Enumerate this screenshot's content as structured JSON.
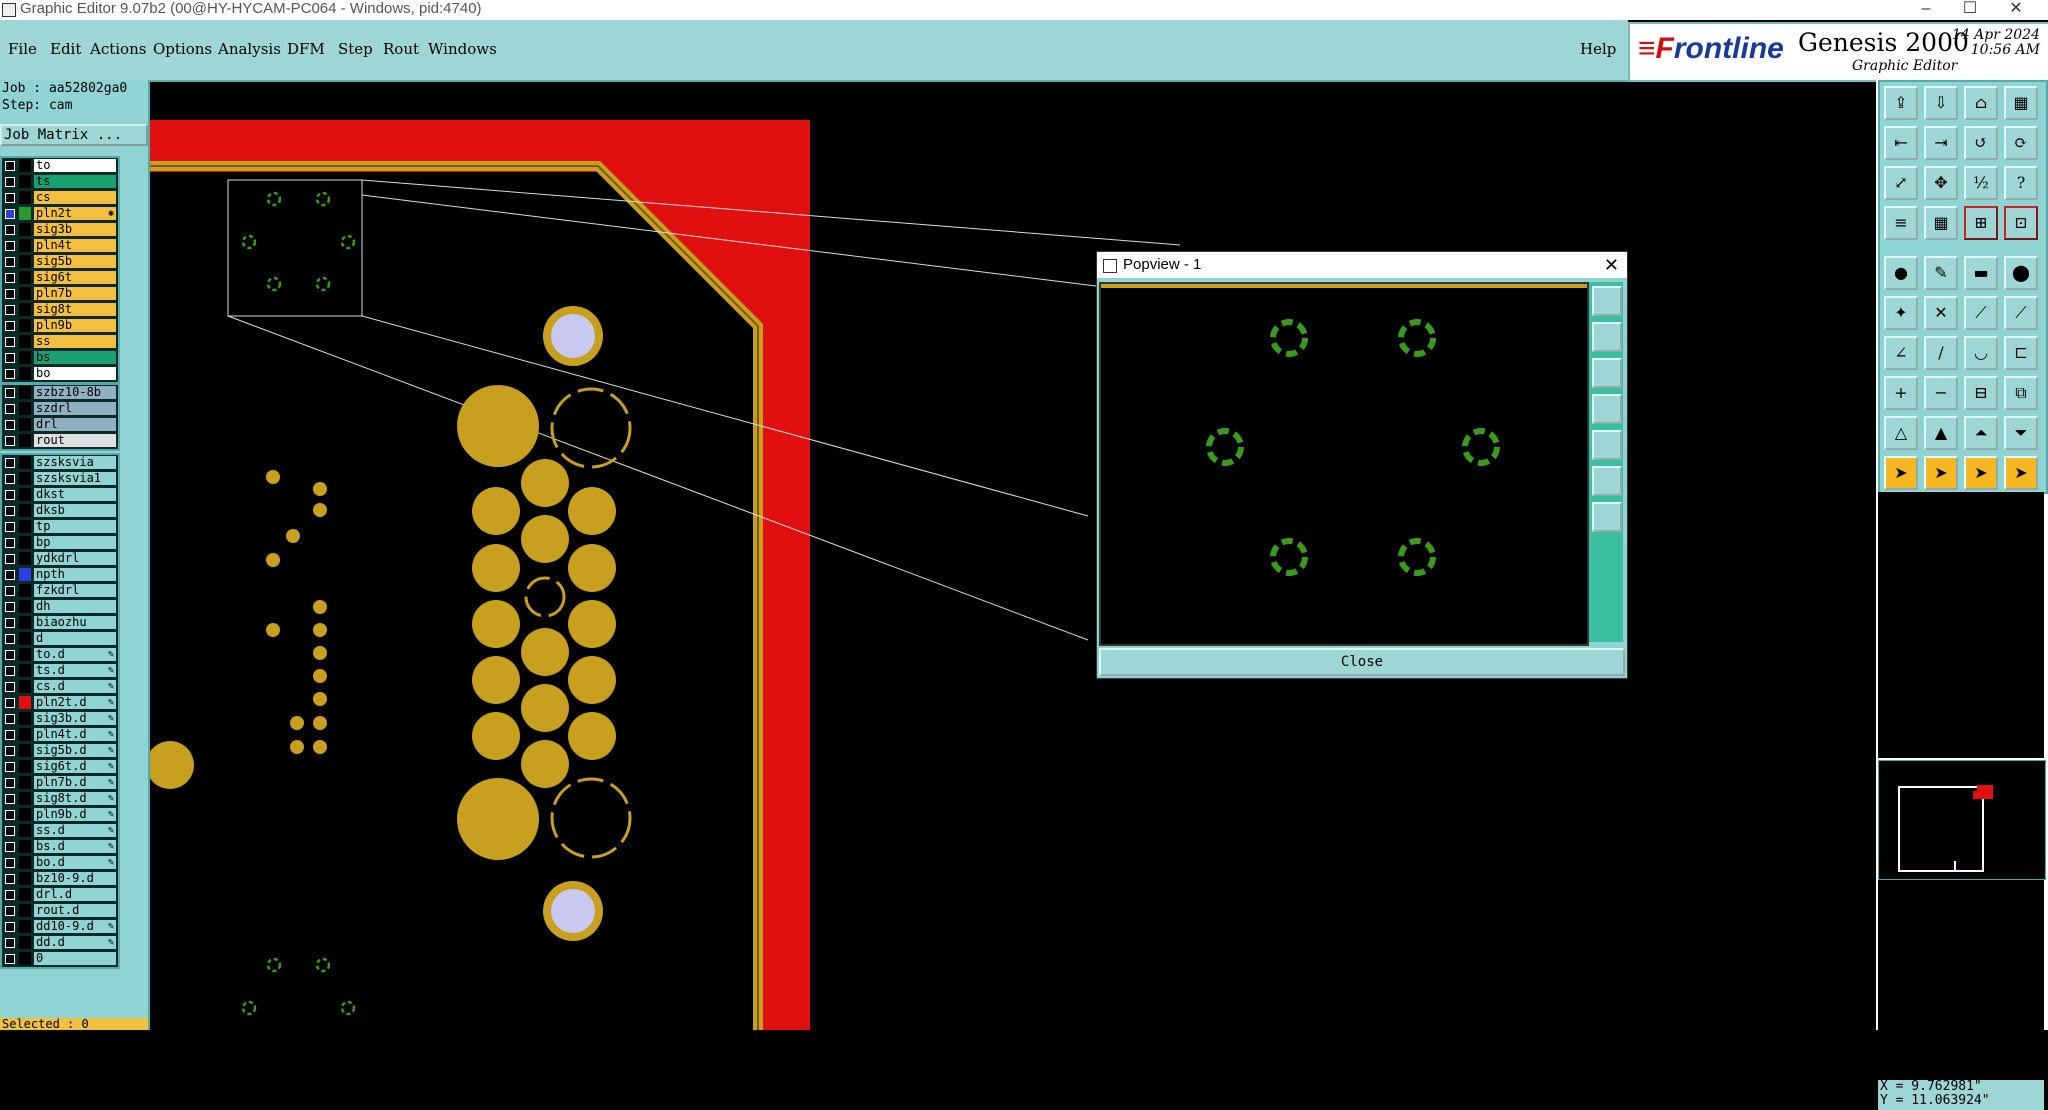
{
  "window": {
    "title": "Graphic Editor 9.07b2 (00@HY-HYCAM-PC064 - Windows, pid:4740)",
    "minimize": "–",
    "maximize": "☐",
    "close": "✕"
  },
  "menu": [
    "File",
    "Edit",
    "Actions",
    "Options",
    "Analysis",
    "DFM",
    "Step",
    "Rout",
    "Windows"
  ],
  "help_label": "Help",
  "logo": {
    "brand_prefix": "≡F",
    "brand_rest": "rontline",
    "product": "Genesis 2000",
    "subtitle": "Graphic Editor",
    "date": "14 Apr 2024",
    "time": "10:56 AM"
  },
  "job": {
    "job_line": "Job : aa52802ga0",
    "step_line": "Step: cam",
    "matrix_button": "Job Matrix ..."
  },
  "layer_groups": [
    [
      {
        "name": "to",
        "bg": "#ffffff",
        "sw": "#000000"
      },
      {
        "name": "ts",
        "bg": "#1aa070",
        "sw": "#000000"
      },
      {
        "name": "cs",
        "bg": "#f5c040",
        "sw": "#000000"
      },
      {
        "name": "pln2t",
        "bg": "#f5c040",
        "sw": "#2a9a2a",
        "mark": "✱",
        "active": true
      },
      {
        "name": "sig3b",
        "bg": "#f5c040",
        "sw": "#000000"
      },
      {
        "name": "pln4t",
        "bg": "#f5c040",
        "sw": "#000000"
      },
      {
        "name": "sig5b",
        "bg": "#f5c040",
        "sw": "#000000"
      },
      {
        "name": "sig6t",
        "bg": "#f5c040",
        "sw": "#000000"
      },
      {
        "name": "pln7b",
        "bg": "#f5c040",
        "sw": "#000000"
      },
      {
        "name": "sig8t",
        "bg": "#f5c040",
        "sw": "#000000"
      },
      {
        "name": "pln9b",
        "bg": "#f5c040",
        "sw": "#000000"
      },
      {
        "name": "ss",
        "bg": "#f5c040",
        "sw": "#000000"
      },
      {
        "name": "bs",
        "bg": "#1aa070",
        "sw": "#000000"
      },
      {
        "name": "bo",
        "bg": "#ffffff",
        "sw": "#000000"
      }
    ],
    [
      {
        "name": "szbz10-8b",
        "bg": "#90b0c0",
        "sw": "#000000"
      },
      {
        "name": "szdrl",
        "bg": "#90b0c0",
        "sw": "#000000"
      },
      {
        "name": "drl",
        "bg": "#90b0c0",
        "sw": "#000000"
      },
      {
        "name": "rout",
        "bg": "#e0e0e0",
        "sw": "#000000"
      }
    ],
    [
      {
        "name": "szsksvia",
        "bg": "#8fd3d3",
        "sw": "#000000"
      },
      {
        "name": "szsksvia1",
        "bg": "#8fd3d3",
        "sw": "#000000"
      },
      {
        "name": "dkst",
        "bg": "#8fd3d3",
        "sw": "#000000"
      },
      {
        "name": "dksb",
        "bg": "#8fd3d3",
        "sw": "#000000"
      },
      {
        "name": "tp",
        "bg": "#8fd3d3",
        "sw": "#000000"
      },
      {
        "name": "bp",
        "bg": "#8fd3d3",
        "sw": "#000000"
      },
      {
        "name": "ydkdrl",
        "bg": "#8fd3d3",
        "sw": "#000000"
      },
      {
        "name": "npth",
        "bg": "#8fd3d3",
        "sw": "#2a40e0"
      },
      {
        "name": "fzkdrl",
        "bg": "#8fd3d3",
        "sw": "#000000"
      },
      {
        "name": "dh",
        "bg": "#8fd3d3",
        "sw": "#000000"
      },
      {
        "name": "biaozhu",
        "bg": "#8fd3d3",
        "sw": "#000000"
      },
      {
        "name": "d",
        "bg": "#8fd3d3",
        "sw": "#000000"
      },
      {
        "name": "to.d",
        "bg": "#8fd3d3",
        "sw": "#000000",
        "mark": "✎"
      },
      {
        "name": "ts.d",
        "bg": "#8fd3d3",
        "sw": "#000000",
        "mark": "✎"
      },
      {
        "name": "cs.d",
        "bg": "#8fd3d3",
        "sw": "#000000",
        "mark": "✎"
      },
      {
        "name": "pln2t.d",
        "bg": "#8fd3d3",
        "sw": "#e01010",
        "mark": "✎"
      },
      {
        "name": "sig3b.d",
        "bg": "#8fd3d3",
        "sw": "#000000",
        "mark": "✎"
      },
      {
        "name": "pln4t.d",
        "bg": "#8fd3d3",
        "sw": "#000000",
        "mark": "✎"
      },
      {
        "name": "sig5b.d",
        "bg": "#8fd3d3",
        "sw": "#000000",
        "mark": "✎"
      },
      {
        "name": "sig6t.d",
        "bg": "#8fd3d3",
        "sw": "#000000",
        "mark": "✎"
      },
      {
        "name": "pln7b.d",
        "bg": "#8fd3d3",
        "sw": "#000000",
        "mark": "✎"
      },
      {
        "name": "sig8t.d",
        "bg": "#8fd3d3",
        "sw": "#000000",
        "mark": "✎"
      },
      {
        "name": "pln9b.d",
        "bg": "#8fd3d3",
        "sw": "#000000",
        "mark": "✎"
      },
      {
        "name": "ss.d",
        "bg": "#8fd3d3",
        "sw": "#000000",
        "mark": "✎"
      },
      {
        "name": "bs.d",
        "bg": "#8fd3d3",
        "sw": "#000000",
        "mark": "✎"
      },
      {
        "name": "bo.d",
        "bg": "#8fd3d3",
        "sw": "#000000",
        "mark": "✎"
      },
      {
        "name": "bz10-9.d",
        "bg": "#8fd3d3",
        "sw": "#000000"
      },
      {
        "name": "drl.d",
        "bg": "#8fd3d3",
        "sw": "#000000"
      },
      {
        "name": "rout.d",
        "bg": "#8fd3d3",
        "sw": "#000000"
      },
      {
        "name": "dd10-9.d",
        "bg": "#8fd3d3",
        "sw": "#000000",
        "mark": "✎"
      },
      {
        "name": "dd.d",
        "bg": "#8fd3d3",
        "sw": "#000000",
        "mark": "✎"
      },
      {
        "name": "0",
        "bg": "#8fd3d3",
        "sw": "#000000"
      }
    ]
  ],
  "selected_label": "Selected : 0",
  "popview": {
    "title": "Popview - 1",
    "close_label": "Close",
    "close_x": "✕"
  },
  "coords": {
    "x": "X = 9.762981\"",
    "y": "Y = 11.063924\""
  },
  "colors": {
    "copper": "#c8a020",
    "outline": "#e01010",
    "via_fill": "#c8c8f0",
    "antipad": "#3a9a20",
    "panel": "#8fd3d3"
  },
  "toolbar_icons": [
    "step-up-icon",
    "step-down-icon",
    "home-icon",
    "window-icon",
    "pan-left-icon",
    "pan-right-icon",
    "zoom-prev-icon",
    "redraw-icon",
    "zoom-fit-icon",
    "zoom-center-icon",
    "scale-1-2-icon",
    "help-icon",
    "layers-icon",
    "grid-icon",
    "snap-icon",
    "measure-icon",
    "feature-icon",
    "draw-icon",
    "line-icon",
    "pad-icon",
    "move-icon",
    "delete-icon",
    "node-icon",
    "edit-node-icon",
    "angle-icon",
    "slash-icon",
    "arc-icon",
    "text-icon",
    "add-icon",
    "minus-icon",
    "dimension-icon",
    "copy-icon",
    "triangle-icon",
    "triangle2-icon",
    "triangle3-icon",
    "triangle4-icon",
    "cursor-icon",
    "cursor2-icon",
    "cursor3-icon",
    "cursor4-icon"
  ]
}
